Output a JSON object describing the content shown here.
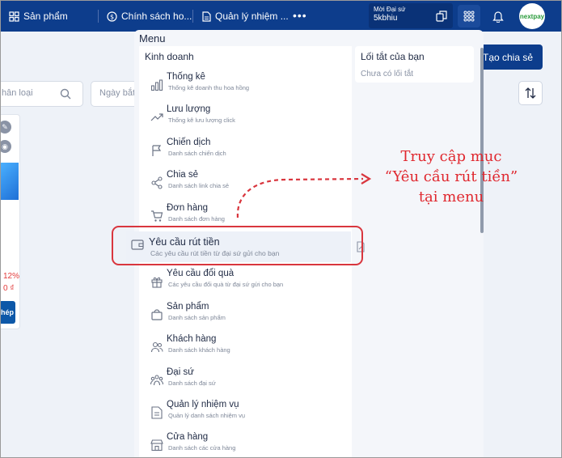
{
  "topbar": {
    "nav_items": [
      {
        "label": "Sản phẩm",
        "icon": "grid-icon"
      },
      {
        "label": "Chính sách ho...",
        "icon": "dollar-badge-icon"
      },
      {
        "label": "Quản lý nhiệm ...",
        "icon": "document-icon"
      }
    ],
    "more": "•••",
    "agent_label": "Mời Đại sứ",
    "agent_value": "5kbhiu",
    "logo_text": "nextpay"
  },
  "background": {
    "create_button": "Tạo chia sẻ",
    "filter_placeholder": "hân loại",
    "date_placeholder": "Ngày bắt",
    "card_percent": "12%",
    "card_price": "0 ₫",
    "card_button": "hép"
  },
  "menu": {
    "title": "Menu",
    "business_title": "Kinh doanh",
    "items": [
      {
        "label": "Thống kê",
        "desc": "Thống kê doanh thu hoa hồng"
      },
      {
        "label": "Lưu lượng",
        "desc": "Thống kê lưu lượng click"
      },
      {
        "label": "Chiến dịch",
        "desc": "Danh sách chiến dịch"
      },
      {
        "label": "Chia sẻ",
        "desc": "Danh sách link chia sẻ"
      },
      {
        "label": "Đơn hàng",
        "desc": "Danh sách đơn hàng"
      },
      {
        "label": "Yêu cầu đổi quà",
        "desc": "Các yêu cầu đổi quà từ đại sứ gửi cho bạn"
      },
      {
        "label": "Sản phẩm",
        "desc": "Danh sách sản phẩm"
      },
      {
        "label": "Khách hàng",
        "desc": "Danh sách khách hàng"
      },
      {
        "label": "Đại sứ",
        "desc": "Danh sách đại sứ"
      },
      {
        "label": "Quản lý nhiệm vụ",
        "desc": "Quản lý danh sách nhiệm vụ"
      },
      {
        "label": "Cửa hàng",
        "desc": "Danh sách các cửa hàng"
      }
    ],
    "highlighted": {
      "label": "Yêu cầu rút tiền",
      "desc": "Các yêu cầu rút tiền từ đại sứ gửi cho bạn"
    },
    "shortcuts_title": "Lối tắt của bạn",
    "shortcuts_empty": "Chưa có lối tắt"
  },
  "annotation": {
    "line1": "Truy cập mục",
    "line2": "“Yêu cầu rút tiền”",
    "line3": "tại menu"
  },
  "colors": {
    "navbar": "#0d3d8c",
    "highlight_ring": "#d9363e",
    "annotation": "#e0282f"
  }
}
